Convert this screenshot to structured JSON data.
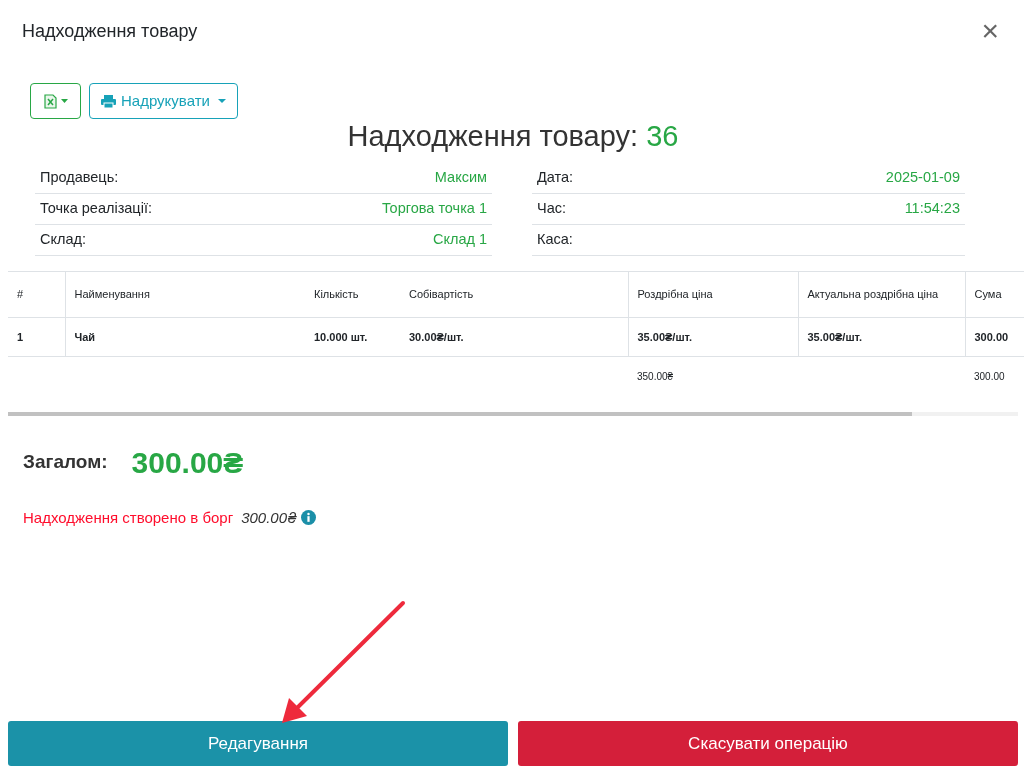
{
  "dialog": {
    "title": "Надходження товару",
    "close": "×"
  },
  "toolbar": {
    "print_button": "Надрукувати"
  },
  "heading": {
    "text": "Надходження товару:",
    "number": "36"
  },
  "info_left": [
    {
      "label": "Продавець:",
      "value": "Максим"
    },
    {
      "label": "Точка реалізації:",
      "value": "Торгова точка 1"
    },
    {
      "label": "Склад:",
      "value": "Склад 1"
    }
  ],
  "info_right": [
    {
      "label": "Дата:",
      "value": "2025-01-09"
    },
    {
      "label": "Час:",
      "value": "11:54:23"
    },
    {
      "label": "Каса:"
    }
  ],
  "table": {
    "columns": [
      {
        "label": "#"
      },
      {
        "label": "Найменування"
      },
      {
        "label": "Кількість"
      },
      {
        "label": "Собівартість"
      },
      {
        "label": "Роздрібна ціна",
        "total": "350.00₴"
      },
      {
        "label": "Актуальна роздрібна ціна"
      },
      {
        "label": "Сума",
        "total": "300.00"
      }
    ],
    "rows": [
      [
        "1",
        "Чай",
        "10.000 шт.",
        "30.00₴/шт.",
        "35.00₴/шт.",
        "35.00₴/шт.",
        "300.00"
      ]
    ]
  },
  "total": {
    "label": "Загалом:",
    "value": "300.00₴"
  },
  "debt_note": {
    "text": "Надходження створено в борг",
    "amount": "300.00₴"
  },
  "buttons": [
    {
      "label": "Редагування",
      "kind": "primary"
    },
    {
      "label": "Скасувати операцію",
      "kind": "danger"
    }
  ]
}
